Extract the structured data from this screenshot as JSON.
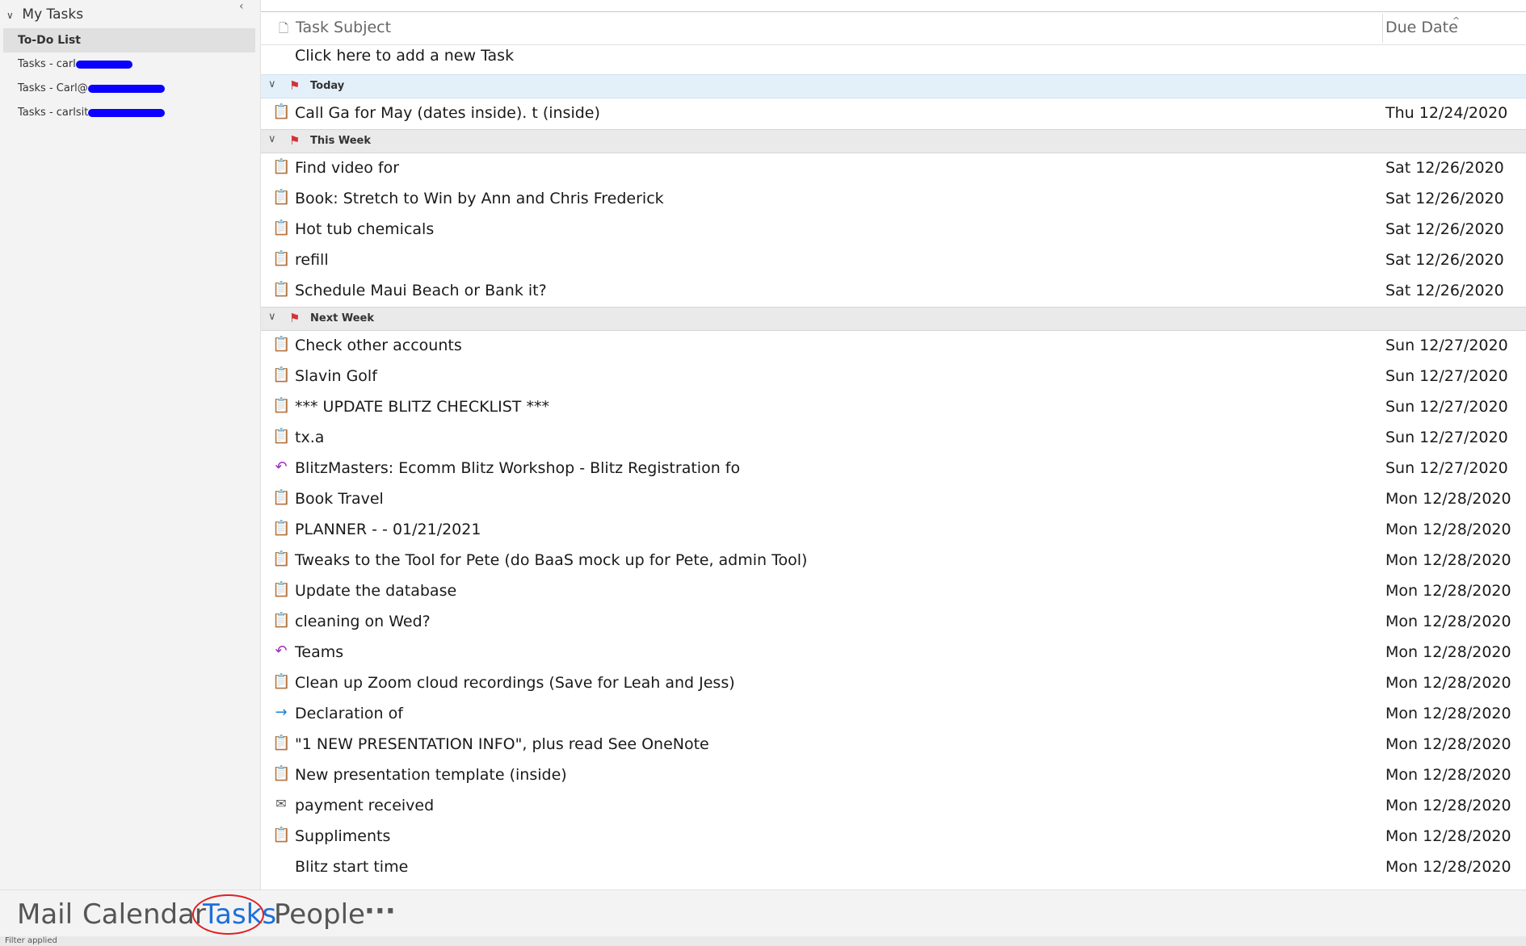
{
  "folders": {
    "root_label": "My Tasks",
    "items": [
      {
        "label": "To-Do List",
        "selected": true
      },
      {
        "label": "Tasks - carl",
        "selected": false
      },
      {
        "label": "Tasks - Carl@",
        "selected": false
      },
      {
        "label": "Tasks - carlsit",
        "selected": false
      }
    ]
  },
  "columns": {
    "subject": "Task Subject",
    "due": "Due Date"
  },
  "add_task_label": "Click here to add a new Task",
  "groups": {
    "today": "Today",
    "this_week": "This Week",
    "next_week": "Next Week"
  },
  "tasks": {
    "today": [
      {
        "subject": "Call Ga for May (dates inside). t (inside)",
        "due": "Thu 12/24/2020",
        "icon": "task-icon"
      }
    ],
    "this_week": [
      {
        "subject": "Find video for",
        "due": "Sat 12/26/2020",
        "icon": "task-icon"
      },
      {
        "subject": "Book: Stretch to Win by Ann and Chris Frederick",
        "due": "Sat 12/26/2020",
        "icon": "task-icon"
      },
      {
        "subject": "Hot tub chemicals",
        "due": "Sat 12/26/2020",
        "icon": "task-icon"
      },
      {
        "subject": "refill",
        "due": "Sat 12/26/2020",
        "icon": "task-icon"
      },
      {
        "subject": "Schedule Maui Beach or Bank it?",
        "due": "Sat 12/26/2020",
        "icon": "task-icon"
      }
    ],
    "next_week": [
      {
        "subject": "Check other accounts",
        "due": "Sun 12/27/2020",
        "icon": "task-icon"
      },
      {
        "subject": "Slavin Golf",
        "due": "Sun 12/27/2020",
        "icon": "task-icon"
      },
      {
        "subject": " *** UPDATE BLITZ CHECKLIST ***",
        "due": "Sun 12/27/2020",
        "icon": "task-icon"
      },
      {
        "subject": "tx.a",
        "due": "Sun 12/27/2020",
        "icon": "task-icon"
      },
      {
        "subject": "BlitzMasters: Ecomm Blitz Workshop - Blitz Registration fo",
        "due": "Sun 12/27/2020",
        "icon": "reply-arrow-icon"
      },
      {
        "subject": "Book Travel",
        "due": "Mon 12/28/2020",
        "icon": "task-icon"
      },
      {
        "subject": "PLANNER - - 01/21/2021",
        "due": "Mon 12/28/2020",
        "icon": "task-icon"
      },
      {
        "subject": "Tweaks to the Tool for Pete  (do BaaS mock up for Pete, admin Tool)",
        "due": "Mon 12/28/2020",
        "icon": "task-icon"
      },
      {
        "subject": "Update the database",
        "due": "Mon 12/28/2020",
        "icon": "task-icon"
      },
      {
        "subject": "cleaning on Wed?",
        "due": "Mon 12/28/2020",
        "icon": "task-icon"
      },
      {
        "subject": "Teams",
        "due": "Mon 12/28/2020",
        "icon": "reply-arrow-icon"
      },
      {
        "subject": "Clean up Zoom cloud recordings (Save for Leah and Jess)",
        "due": "Mon 12/28/2020",
        "icon": "task-icon"
      },
      {
        "subject": "Declaration of",
        "due": "Mon 12/28/2020",
        "icon": "forward-arrow-icon"
      },
      {
        "subject": "\"1 NEW PRESENTATION INFO\", plus read See OneNote",
        "due": "Mon 12/28/2020",
        "icon": "task-icon"
      },
      {
        "subject": "New presentation template (inside)",
        "due": "Mon 12/28/2020",
        "icon": "task-icon"
      },
      {
        "subject": "payment received",
        "due": "Mon 12/28/2020",
        "icon": "flagged-mail-icon"
      },
      {
        "subject": "Suppliments",
        "due": "Mon 12/28/2020",
        "icon": "task-icon"
      },
      {
        "subject": "Blitz start time",
        "due": "Mon 12/28/2020",
        "icon": "none"
      }
    ]
  },
  "nav": {
    "mail": "Mail",
    "calendar": "Calendar",
    "tasks": "Tasks",
    "people": "People",
    "more": "···",
    "active": "tasks"
  },
  "status": "Filter applied",
  "colors": {
    "accent": "#1e6fd9",
    "flag": "#d13438",
    "redaction": "#0a00ff",
    "annotation_circle": "#e02020"
  }
}
